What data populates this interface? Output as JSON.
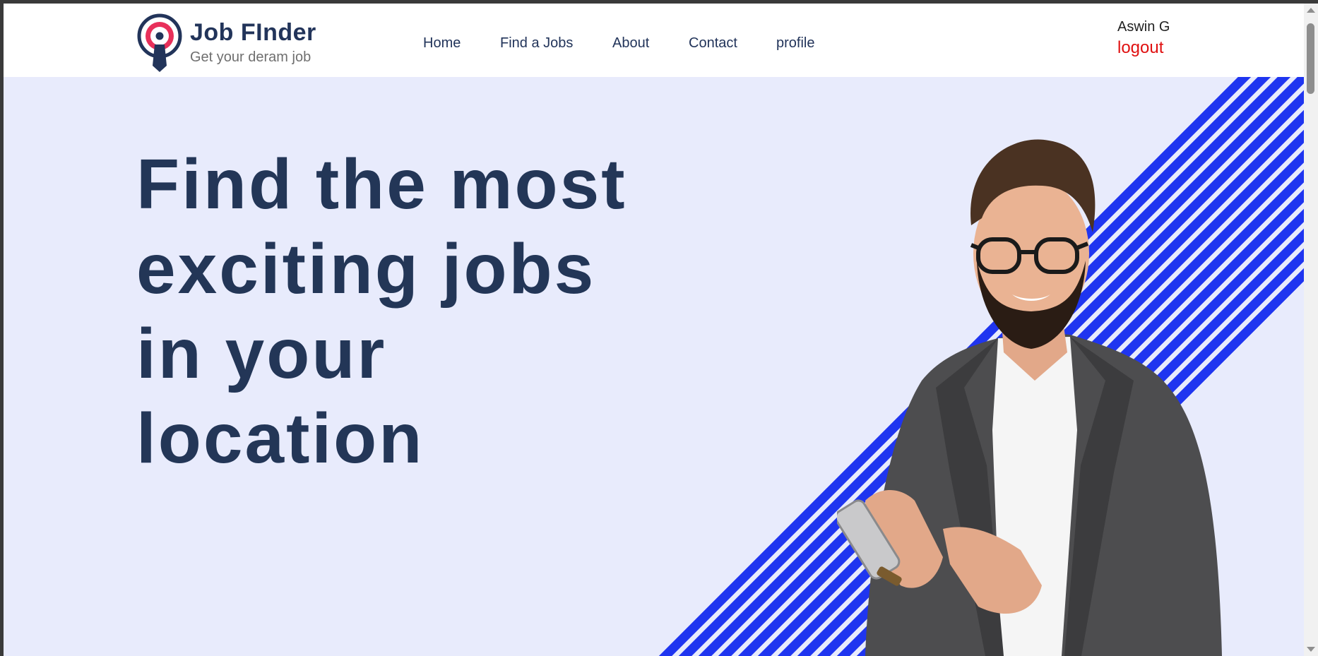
{
  "brand": {
    "title": "Job FInder",
    "tagline": "Get your deram job",
    "logo_icon": "job-finder-logo-icon"
  },
  "nav": {
    "items": [
      {
        "label": "Home"
      },
      {
        "label": "Find a Jobs"
      },
      {
        "label": "About"
      },
      {
        "label": "Contact"
      },
      {
        "label": "profile"
      }
    ]
  },
  "user": {
    "name": "Aswin G",
    "logout_label": "logout"
  },
  "hero": {
    "headline": "Find the most exciting jobs in your location",
    "image": "smiling-man-holding-phone-photo"
  },
  "colors": {
    "brand_navy": "#22345a",
    "logo_accent": "#e8305a",
    "hero_background": "#e8ebfc",
    "stripe_blue": "#1f35f0",
    "logout_red": "#e01010"
  }
}
